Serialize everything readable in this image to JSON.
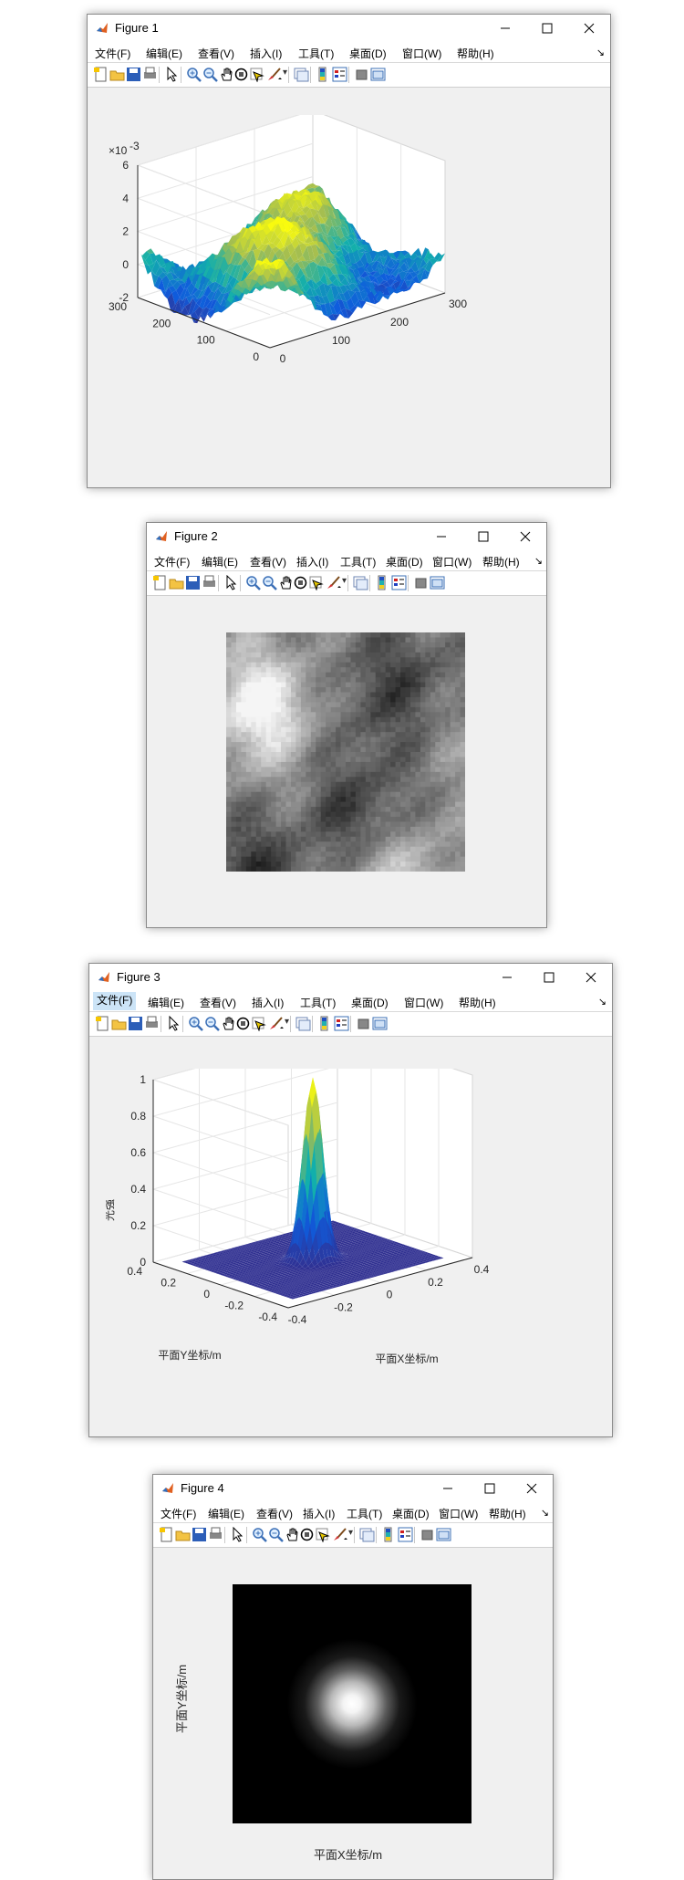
{
  "colors": {
    "window_bg": "#f0f0f0",
    "menu_active": "#cce4f7",
    "axes_text": "#262626",
    "surface_low": "#1f4fd8",
    "surface_mid": "#1ab0b0",
    "surface_high": "#f9e22a",
    "flat_surface": "#3b2e8f"
  },
  "menu": [
    "文件(F)",
    "编辑(E)",
    "查看(V)",
    "插入(I)",
    "工具(T)",
    "桌面(D)",
    "窗口(W)",
    "帮助(H)"
  ],
  "toolbar_icons": [
    "new-figure-icon",
    "open-file-icon",
    "save-icon",
    "print-icon",
    "pointer-icon",
    "zoom-in-icon",
    "zoom-out-icon",
    "pan-icon",
    "rotate-3d-icon",
    "data-cursor-icon",
    "brush-icon",
    "link-plot-icon",
    "colorbar-icon",
    "legend-icon",
    "hide-plot-tools-icon",
    "show-plot-tools-icon"
  ],
  "figures": [
    {
      "title": "Figure 1",
      "axes": {
        "exponent_label": "×10",
        "exponent_power": "-3",
        "z_ticks": [
          "6",
          "4",
          "2",
          "0",
          "-2"
        ],
        "y_ticks": [
          "300",
          "200",
          "100",
          "0"
        ],
        "x_ticks": [
          "0",
          "100",
          "200",
          "300"
        ],
        "zlim": [
          -0.002,
          0.006
        ],
        "xlim": [
          0,
          300
        ],
        "ylim": [
          0,
          300
        ]
      },
      "surface": {
        "type": "surf",
        "colormap": "parula",
        "description_note": "random rough surface"
      }
    },
    {
      "title": "Figure 2",
      "image": {
        "type": "grayscale-image",
        "colormap": "gray"
      }
    },
    {
      "title": "Figure 3",
      "axes": {
        "zlabel": "光强",
        "xlabel": "平面X坐标/m",
        "ylabel": "平面Y坐标/m",
        "z_ticks": [
          "1",
          "0.8",
          "0.6",
          "0.4",
          "0.2",
          "0"
        ],
        "y_ticks": [
          "0.4",
          "0.2",
          "0",
          "-0.2",
          "-0.4"
        ],
        "x_ticks": [
          "-0.4",
          "-0.2",
          "0",
          "0.2",
          "0.4"
        ],
        "zlim": [
          0,
          1
        ],
        "xlim": [
          -0.4,
          0.4
        ],
        "ylim": [
          -0.4,
          0.4
        ]
      },
      "surface": {
        "type": "surf",
        "colormap": "parula",
        "peak": 1.0
      }
    },
    {
      "title": "Figure 4",
      "axes": {
        "xlabel": "平面X坐标/m",
        "ylabel": "平面Y坐标/m"
      },
      "image": {
        "type": "gaussian-spot",
        "colormap": "gray"
      }
    }
  ]
}
